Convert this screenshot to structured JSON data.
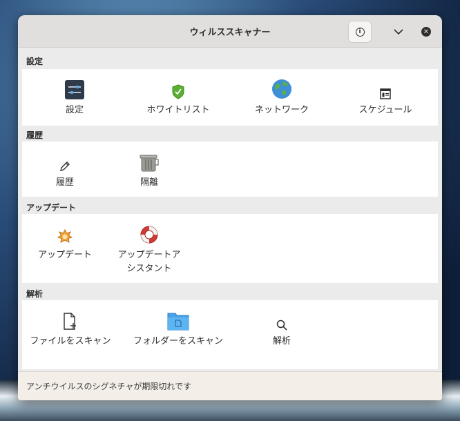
{
  "window": {
    "title": "ウィルススキャナー"
  },
  "sections": {
    "settings": {
      "title": "設定",
      "items": [
        {
          "label": "設定",
          "icon": "settings-sliders-icon"
        },
        {
          "label": "ホワイトリスト",
          "icon": "shield-check-icon"
        },
        {
          "label": "ネットワーク",
          "icon": "globe-icon"
        },
        {
          "label": "スケジュール",
          "icon": "schedule-icon"
        }
      ]
    },
    "history": {
      "title": "履歴",
      "items": [
        {
          "label": "履歴",
          "icon": "pencil-icon"
        },
        {
          "label": "隔離",
          "icon": "trash-bin-icon"
        }
      ]
    },
    "update": {
      "title": "アップデート",
      "items": [
        {
          "label": "アップデート",
          "icon": "update-star-icon"
        },
        {
          "label": "アップデートアシスタント",
          "icon": "lifebuoy-icon"
        }
      ]
    },
    "analysis": {
      "title": "解析",
      "items": [
        {
          "label": "ファイルをスキャン",
          "icon": "file-add-icon"
        },
        {
          "label": "フォルダーをスキャン",
          "icon": "folder-icon"
        },
        {
          "label": "解析",
          "icon": "search-icon"
        }
      ]
    }
  },
  "status": {
    "message": "アンチウイルスのシグネチャが期限切れです"
  }
}
